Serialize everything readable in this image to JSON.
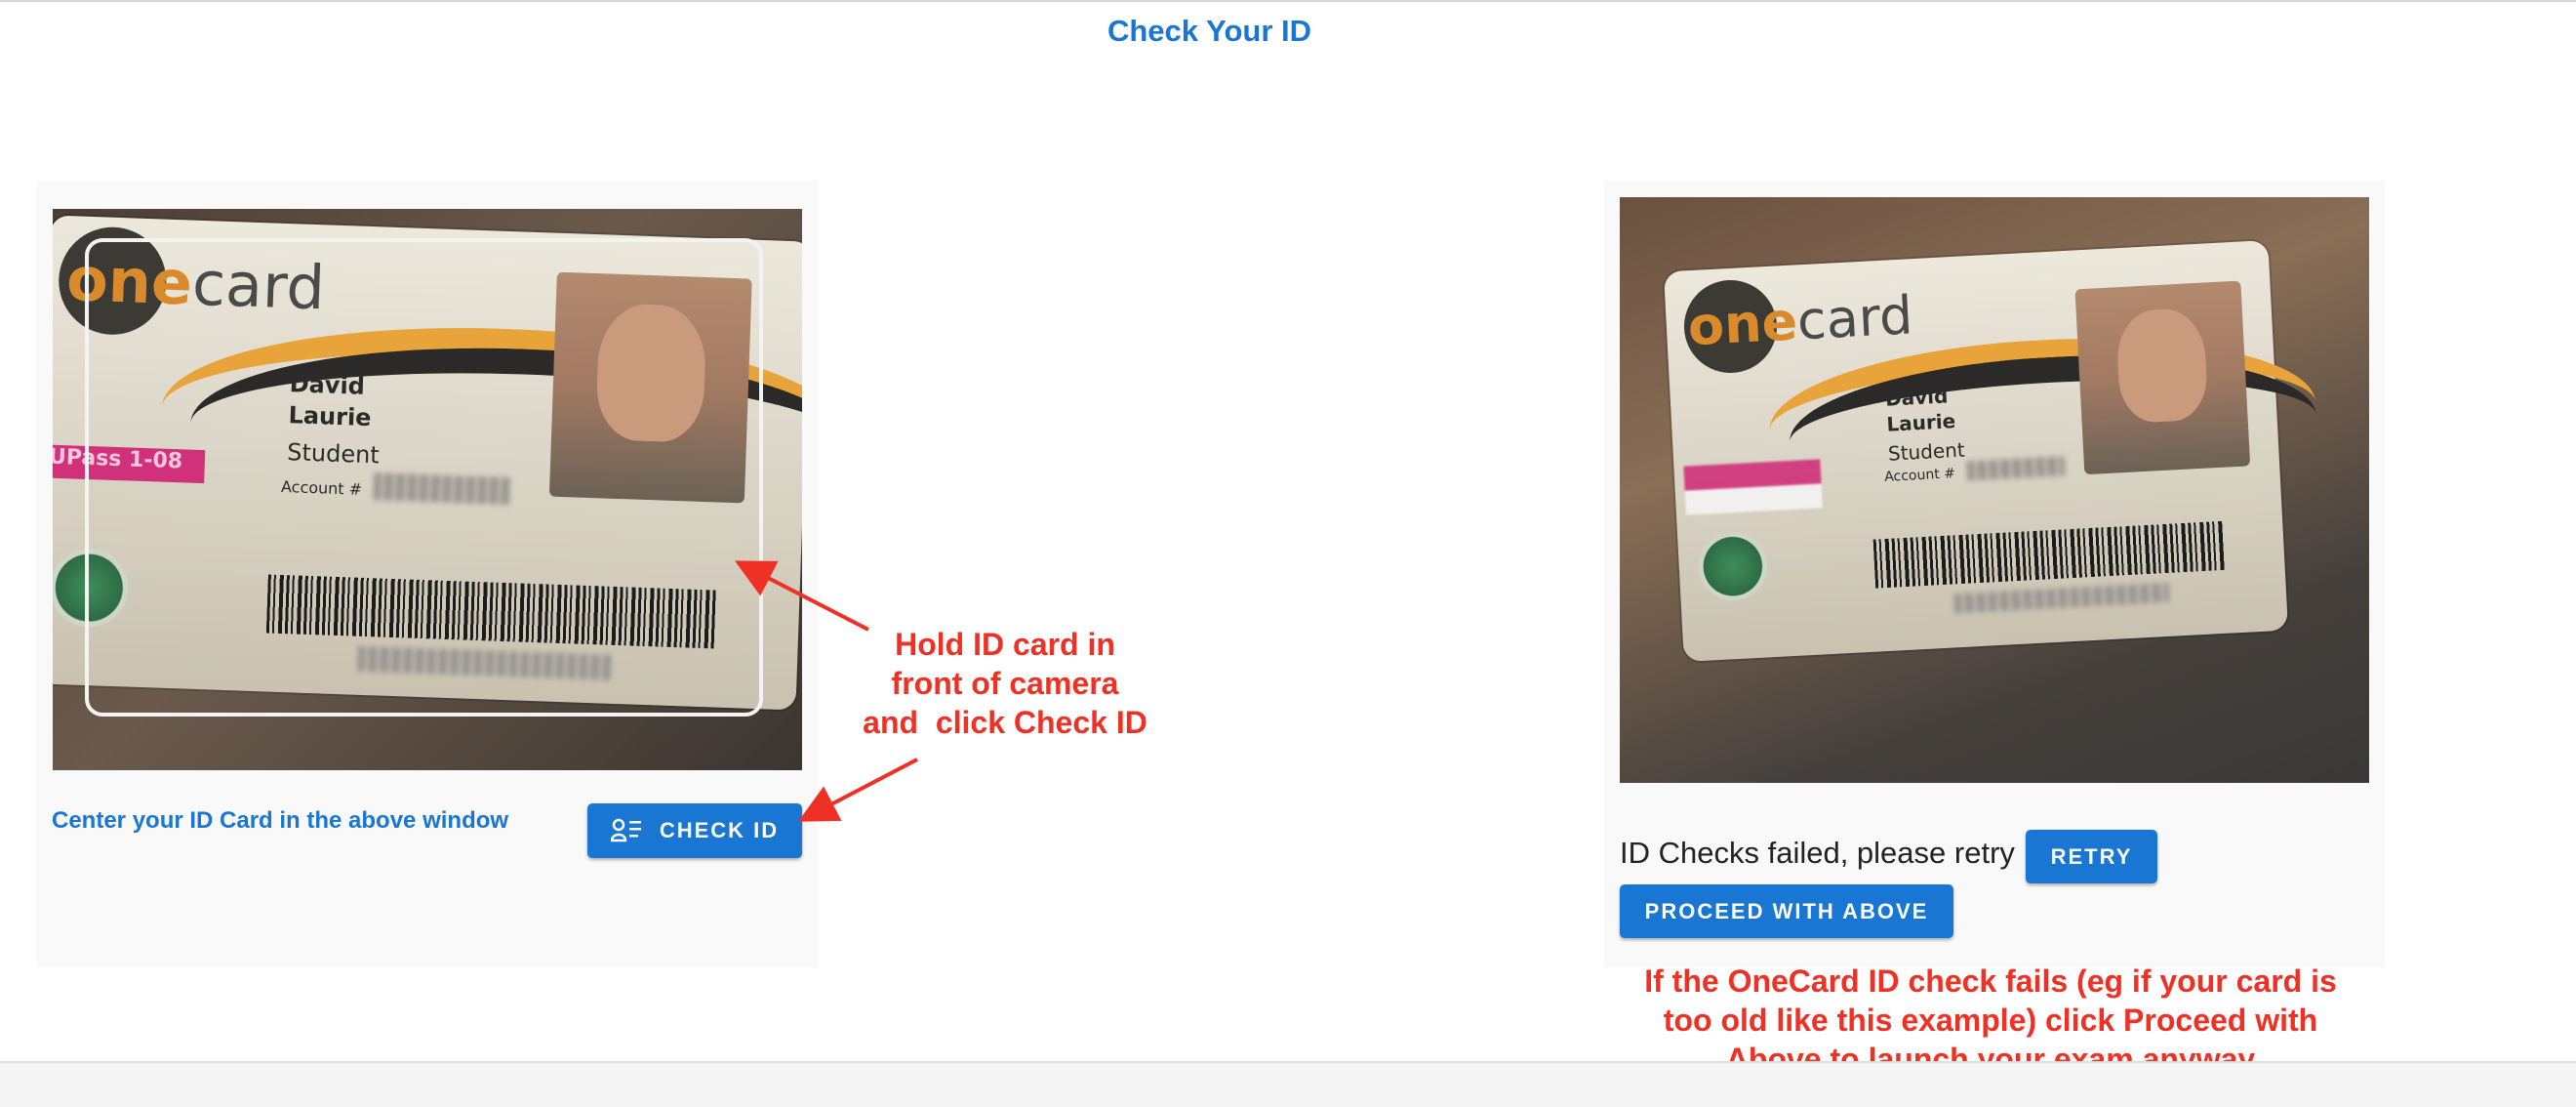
{
  "page": {
    "title": "Check Your ID"
  },
  "left_panel": {
    "camera_card": {
      "logo_one": "one",
      "logo_card": "card",
      "name_first": "David",
      "name_last": "Laurie",
      "role": "Student",
      "account_label": "Account #",
      "upass_label": "UPass 1-08"
    },
    "hint": "Center your ID Card in the above window",
    "check_button_label": "CHECK ID",
    "check_button_icon": "person-list-icon"
  },
  "right_panel": {
    "captured_card": {
      "logo_one": "one",
      "logo_card": "card",
      "name_first": "David",
      "name_last": "Laurie",
      "role": "Student",
      "account_label": "Account #"
    },
    "status": "ID Checks failed, please retry",
    "retry_label": "RETRY",
    "proceed_label": "PROCEED WITH ABOVE"
  },
  "annotations": {
    "left": [
      "Hold ID card in",
      "front of camera",
      "and  click Check ID"
    ],
    "right": [
      "If the OneCard ID check fails (eg if your card is",
      "too old like this example) click Proceed with",
      "Above to launch your exam anyway"
    ]
  },
  "colors": {
    "accent": "#1976d2",
    "annotation": "#ee3124",
    "panel_bg": "#f9f9f9"
  }
}
